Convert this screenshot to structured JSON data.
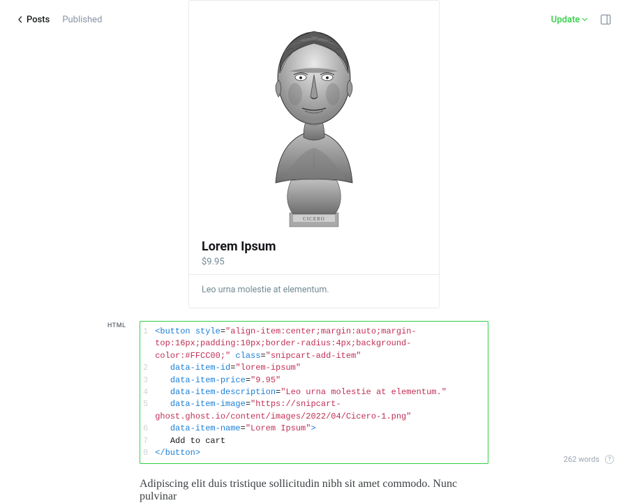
{
  "topbar": {
    "back_label": "Posts",
    "status_label": "Published",
    "update_label": "Update"
  },
  "product": {
    "title": "Lorem Ipsum",
    "price": "$9.95",
    "description": "Leo urna molestie at elementum."
  },
  "html_block": {
    "label": "HTML",
    "lines": {
      "l1a": "<button",
      "l1b": " style",
      "l1c": "=",
      "l1d": "\"align-item:center;margin:auto;margin-top:16px;padding:10px;border-radius:4px;background-color:#FFCC00;\"",
      "l1e": " class",
      "l1f": "=",
      "l1g": "\"snipcart-add-item\"",
      "l2a": "   data-item-id",
      "l2b": "=",
      "l2c": "\"lorem-ipsum\"",
      "l3a": "   data-item-price",
      "l3b": "=",
      "l3c": "\"9.95\"",
      "l4a": "   data-item-description",
      "l4b": "=",
      "l4c": "\"Leo urna molestie at elementum.\"",
      "l5a": "   data-item-image",
      "l5b": "=",
      "l5c": "\"https://snipcart-ghost.ghost.io/content/images/2022/04/Cicero-1.png\"",
      "l6a": "   data-item-name",
      "l6b": "=",
      "l6c": "\"Lorem Ipsum\"",
      "l6d": ">",
      "l7": "   Add to cart",
      "l8": "</button>"
    },
    "gutter": "1\n \n \n2\n3\n4\n5\n \n6\n7\n8"
  },
  "body_text": "Adipiscing elit duis tristique sollicitudin nibh sit amet commodo. Nunc pulvinar",
  "footer": {
    "word_count": "262 words"
  }
}
